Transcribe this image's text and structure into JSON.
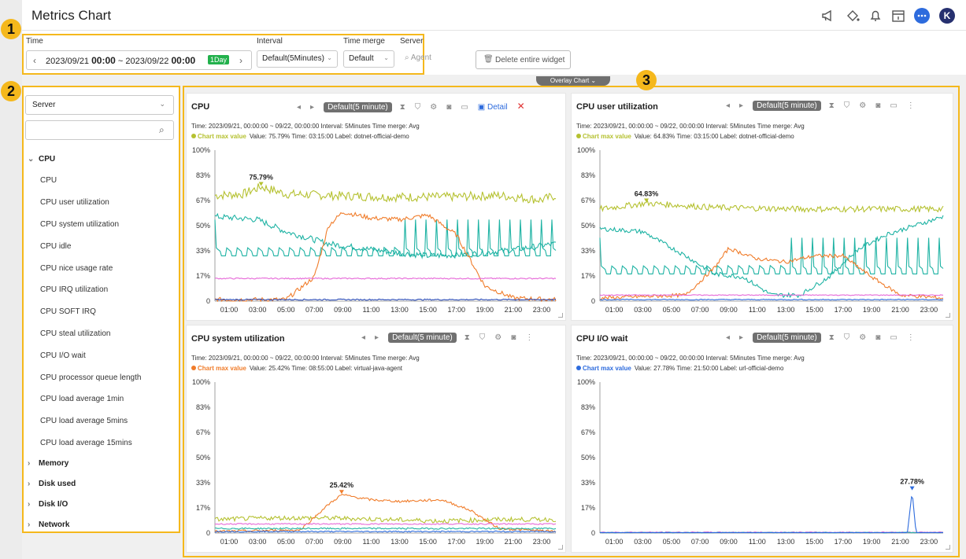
{
  "header": {
    "title": "Metrics Chart",
    "icons": [
      "megaphone-icon",
      "paint-bucket-icon",
      "bell-icon",
      "calendar-icon",
      "chat-icon",
      "user-avatar-icon"
    ],
    "avatar_letter": "K"
  },
  "badges": [
    "1",
    "2",
    "3"
  ],
  "toolbar": {
    "time_label": "Time",
    "time_range_prefix": "2023/09/21 ",
    "time_start_bold": "00:00",
    "time_sep": " ~ 2023/09/22 ",
    "time_end_bold": "00:00",
    "day_badge": "1Day",
    "interval_label": "Interval",
    "interval_value": "Default(5Minutes)",
    "merge_label": "Time merge",
    "merge_value": "Default",
    "server_label": "Server",
    "agent_placeholder": "Agent",
    "delete_label": "Delete entire widget"
  },
  "sidebar": {
    "server_select": "Server",
    "search_placeholder": "",
    "groups": [
      {
        "label": "CPU",
        "expanded": true,
        "items": [
          "CPU",
          "CPU user utilization",
          "CPU system utilization",
          "CPU idle",
          "CPU nice usage rate",
          "CPU IRQ utilization",
          "CPU SOFT IRQ",
          "CPU steal utilization",
          "CPU I/O wait",
          "CPU processor queue length",
          "CPU load average 1min",
          "CPU load average 5mins",
          "CPU load average 15mins"
        ]
      },
      {
        "label": "Memory",
        "expanded": false
      },
      {
        "label": "Disk used",
        "expanded": false
      },
      {
        "label": "Disk I/O",
        "expanded": false
      },
      {
        "label": "Network",
        "expanded": false
      }
    ]
  },
  "overlay_tab": "Overlay Chart ⌄",
  "colors": {
    "accent": "#f5b81c",
    "olive": "#b5c130",
    "orange": "#f07c2a",
    "teal": "#1fb3a4",
    "blue": "#2d6bdd",
    "pink": "#e668d8",
    "darkblue": "#2a4bb6"
  },
  "panels": [
    {
      "title": "CPU",
      "pill": "Default(5 minute)",
      "detail": "Detail",
      "meta": "Time: 2023/09/21, 00:00:00 ~ 09/22, 00:00:00   Interval: 5Minutes   Time merge: Avg",
      "max_label": "Chart max value",
      "max_info": "Value: 75.79%   Time: 03:15:00   Label: dotnet-official-demo",
      "max_color": "#b5c130",
      "peak_label": "75.79%"
    },
    {
      "title": "CPU user utilization",
      "pill": "Default(5 minute)",
      "meta": "Time: 2023/09/21, 00:00:00 ~ 09/22, 00:00:00   Interval: 5Minutes   Time merge: Avg",
      "max_label": "Chart max value",
      "max_info": "Value: 64.83%   Time: 03:15:00   Label: dotnet-official-demo",
      "max_color": "#b5c130",
      "peak_label": "64.83%"
    },
    {
      "title": "CPU system utilization",
      "pill": "Default(5 minute)",
      "meta": "Time: 2023/09/21, 00:00:00 ~ 09/22, 00:00:00   Interval: 5Minutes   Time merge: Avg",
      "max_label": "Chart max value",
      "max_info": "Value: 25.42%   Time: 08:55:00   Label: virtual-java-agent",
      "max_color": "#f07c2a",
      "peak_label": "25.42%"
    },
    {
      "title": "CPU I/O wait",
      "pill": "Default(5 minute)",
      "meta": "Time: 2023/09/21, 00:00:00 ~ 09/22, 00:00:00   Interval: 5Minutes   Time merge: Avg",
      "max_label": "Chart max value",
      "max_info": "Value: 27.78%   Time: 21:50:00   Label: url-official-demo",
      "max_color": "#2d6bdd",
      "peak_label": "27.78%"
    }
  ],
  "chart_data": [
    {
      "type": "line",
      "title": "CPU",
      "y_ticks": [
        "100%",
        "83%",
        "67%",
        "50%",
        "33%",
        "17%",
        "0"
      ],
      "x_ticks": [
        "01:00",
        "03:00",
        "05:00",
        "07:00",
        "09:00",
        "11:00",
        "13:00",
        "15:00",
        "17:00",
        "19:00",
        "21:00",
        "23:00"
      ],
      "ylim": [
        0,
        100
      ],
      "xlim_hours": [
        0,
        24
      ],
      "series": [
        {
          "color": "#b5c130",
          "pts": [
            [
              0,
              70
            ],
            [
              2,
              71
            ],
            [
              3.25,
              75.79
            ],
            [
              5,
              71
            ],
            [
              8,
              70
            ],
            [
              12,
              69
            ],
            [
              16,
              69
            ],
            [
              20,
              70
            ],
            [
              23,
              67
            ],
            [
              24,
              70
            ]
          ],
          "noise": 3
        },
        {
          "color": "#1fb3a4",
          "pts": [
            [
              0,
              56
            ],
            [
              3,
              54
            ],
            [
              5,
              46
            ],
            [
              8,
              38
            ],
            [
              12,
              33
            ],
            [
              15,
              30
            ],
            [
              18,
              31
            ],
            [
              21,
              34
            ],
            [
              24,
              38
            ]
          ],
          "noise": 2
        },
        {
          "color": "#1fb3a4",
          "pts": [
            [
              0,
              30
            ],
            [
              24,
              30
            ]
          ],
          "noise": 0,
          "spikes": true
        },
        {
          "color": "#f07c2a",
          "pts": [
            [
              0,
              1
            ],
            [
              5,
              1
            ],
            [
              7,
              16
            ],
            [
              8,
              50
            ],
            [
              9,
              59
            ],
            [
              11,
              55
            ],
            [
              13,
              54
            ],
            [
              15,
              57
            ],
            [
              17,
              44
            ],
            [
              19,
              10
            ],
            [
              21,
              2
            ],
            [
              24,
              1
            ]
          ],
          "noise": 1.5
        },
        {
          "color": "#e668d8",
          "pts": [
            [
              0,
              15
            ],
            [
              24,
              15
            ]
          ],
          "noise": 0.4
        },
        {
          "color": "#2a4bb6",
          "pts": [
            [
              0,
              1
            ],
            [
              24,
              1
            ]
          ],
          "noise": 0.4
        }
      ]
    },
    {
      "type": "line",
      "title": "CPU user utilization",
      "y_ticks": [
        "100%",
        "83%",
        "67%",
        "50%",
        "33%",
        "17%",
        "0"
      ],
      "x_ticks": [
        "01:00",
        "03:00",
        "05:00",
        "07:00",
        "09:00",
        "11:00",
        "13:00",
        "15:00",
        "17:00",
        "19:00",
        "21:00",
        "23:00"
      ],
      "ylim": [
        0,
        100
      ],
      "xlim_hours": [
        0,
        24
      ],
      "series": [
        {
          "color": "#b5c130",
          "pts": [
            [
              0,
              61
            ],
            [
              3.25,
              64.83
            ],
            [
              8,
              62
            ],
            [
              14,
              61
            ],
            [
              20,
              61
            ],
            [
              24,
              61
            ]
          ],
          "noise": 2
        },
        {
          "color": "#1fb3a4",
          "pts": [
            [
              0,
              48
            ],
            [
              3,
              46
            ],
            [
              6,
              30
            ],
            [
              8,
              18
            ],
            [
              10,
              16
            ],
            [
              12,
              4
            ],
            [
              14,
              4
            ],
            [
              16,
              16
            ],
            [
              18,
              34
            ],
            [
              20,
              44
            ],
            [
              22,
              50
            ],
            [
              24,
              56
            ]
          ],
          "noise": 1.5
        },
        {
          "color": "#1fb3a4",
          "pts": [
            [
              0,
              18
            ],
            [
              24,
              18
            ]
          ],
          "noise": 0,
          "spikes": true
        },
        {
          "color": "#f07c2a",
          "pts": [
            [
              0,
              2
            ],
            [
              6,
              4
            ],
            [
              8,
              22
            ],
            [
              9,
              35
            ],
            [
              11,
              28
            ],
            [
              13,
              26
            ],
            [
              15,
              30
            ],
            [
              17,
              30
            ],
            [
              19,
              16
            ],
            [
              21,
              4
            ],
            [
              24,
              2
            ]
          ],
          "noise": 1.2
        },
        {
          "color": "#e668d8",
          "pts": [
            [
              0,
              4
            ],
            [
              24,
              4
            ]
          ],
          "noise": 0.3
        },
        {
          "color": "#2d6bdd",
          "pts": [
            [
              0,
              1
            ],
            [
              24,
              1
            ]
          ],
          "noise": 0.3
        }
      ]
    },
    {
      "type": "line",
      "title": "CPU system utilization",
      "y_ticks": [
        "100%",
        "83%",
        "67%",
        "50%",
        "33%",
        "17%",
        "0"
      ],
      "x_ticks": [
        "01:00",
        "03:00",
        "05:00",
        "07:00",
        "09:00",
        "11:00",
        "13:00",
        "15:00",
        "17:00",
        "19:00",
        "21:00",
        "23:00"
      ],
      "ylim": [
        0,
        100
      ],
      "xlim_hours": [
        0,
        24
      ],
      "series": [
        {
          "color": "#b5c130",
          "pts": [
            [
              0,
              9
            ],
            [
              4,
              10
            ],
            [
              8,
              10
            ],
            [
              12,
              9
            ],
            [
              16,
              8
            ],
            [
              20,
              9
            ],
            [
              24,
              9
            ]
          ],
          "noise": 1.5
        },
        {
          "color": "#f07c2a",
          "pts": [
            [
              0,
              1
            ],
            [
              6,
              2
            ],
            [
              8,
              19
            ],
            [
              8.92,
              25.42
            ],
            [
              11,
              22
            ],
            [
              13,
              21
            ],
            [
              16,
              22
            ],
            [
              18,
              15
            ],
            [
              20,
              3
            ],
            [
              24,
              1
            ]
          ],
          "noise": 0.8
        },
        {
          "color": "#e668d8",
          "pts": [
            [
              0,
              6
            ],
            [
              24,
              6
            ]
          ],
          "noise": 0.4
        },
        {
          "color": "#1fb3a4",
          "pts": [
            [
              0,
              3
            ],
            [
              24,
              3
            ]
          ],
          "noise": 0.5
        },
        {
          "color": "#2d6bdd",
          "pts": [
            [
              0,
              1
            ],
            [
              24,
              1
            ]
          ],
          "noise": 0.4
        }
      ]
    },
    {
      "type": "line",
      "title": "CPU I/O wait",
      "y_ticks": [
        "100%",
        "83%",
        "67%",
        "50%",
        "33%",
        "17%",
        "0"
      ],
      "x_ticks": [
        "01:00",
        "03:00",
        "05:00",
        "07:00",
        "09:00",
        "11:00",
        "13:00",
        "15:00",
        "17:00",
        "19:00",
        "21:00",
        "23:00"
      ],
      "ylim": [
        0,
        100
      ],
      "xlim_hours": [
        0,
        24
      ],
      "series": [
        {
          "color": "#e668d8",
          "pts": [
            [
              0,
              0.5
            ],
            [
              24,
              0.5
            ]
          ],
          "noise": 0.3
        },
        {
          "color": "#1fb3a4",
          "pts": [
            [
              0,
              0.3
            ],
            [
              24,
              0.3
            ]
          ],
          "noise": 0.2
        },
        {
          "color": "#2d6bdd",
          "pts": [
            [
              0,
              0.3
            ],
            [
              21.5,
              0.3
            ],
            [
              21.83,
              27.78
            ],
            [
              22.1,
              0.3
            ],
            [
              24,
              0.3
            ]
          ],
          "noise": 0
        }
      ]
    }
  ]
}
